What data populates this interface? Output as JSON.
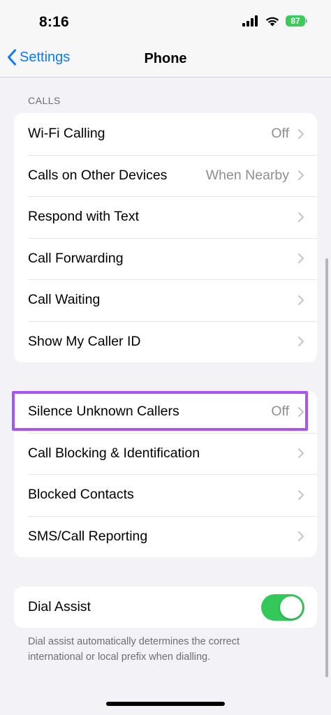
{
  "status_bar": {
    "time": "8:16",
    "battery": "87"
  },
  "nav": {
    "back_label": "Settings",
    "title": "Phone"
  },
  "calls_section": {
    "header": "CALLS",
    "rows": [
      {
        "label": "Wi-Fi Calling",
        "value": "Off"
      },
      {
        "label": "Calls on Other Devices",
        "value": "When Nearby"
      },
      {
        "label": "Respond with Text",
        "value": ""
      },
      {
        "label": "Call Forwarding",
        "value": ""
      },
      {
        "label": "Call Waiting",
        "value": ""
      },
      {
        "label": "Show My Caller ID",
        "value": ""
      }
    ]
  },
  "blocking_section": {
    "rows": [
      {
        "label": "Silence Unknown Callers",
        "value": "Off"
      },
      {
        "label": "Call Blocking & Identification",
        "value": ""
      },
      {
        "label": "Blocked Contacts",
        "value": ""
      },
      {
        "label": "SMS/Call Reporting",
        "value": ""
      }
    ]
  },
  "dial_assist": {
    "label": "Dial Assist",
    "enabled": true,
    "footnote": "Dial assist automatically determines the correct international or local prefix when dialling."
  },
  "colors": {
    "accent": "#0a7aff",
    "toggle_on": "#34c759",
    "highlight": "#a855f7",
    "battery": "#3ec95c"
  }
}
